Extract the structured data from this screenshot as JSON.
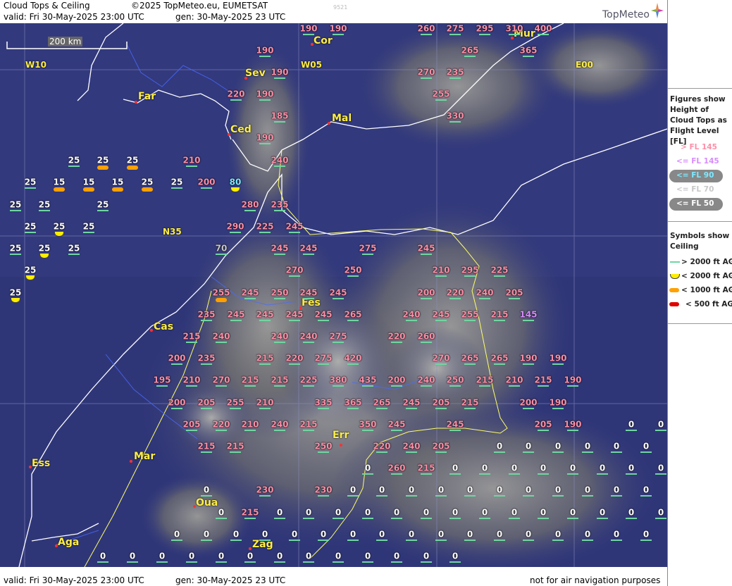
{
  "header": {
    "title": "Cloud Tops & Ceiling",
    "copyright": "©2025 TopMeteo.eu, EUMETSAT",
    "valid": "valid:  Fri  30-May-2025  23:00 UTC",
    "gen": "gen: 30-May-2025 23 UTC",
    "code": "9521",
    "brand": "TopMeteo"
  },
  "footer": {
    "valid": "valid:  Fri  30-May-2025  23:00 UTC",
    "gen": "gen: 30-May-2025 23 UTC",
    "disclaimer": "not for air navigation purposes"
  },
  "scale_label": "200 km",
  "grid_labels": [
    "W10",
    "W05",
    "E00",
    "N35"
  ],
  "cities": [
    "Cor",
    "Mur",
    "Sev",
    "Far",
    "Ced",
    "Mal",
    "Fes",
    "Cas",
    "Err",
    "Mar",
    "Ess",
    "Oua",
    "Aga",
    "Zag"
  ],
  "legend": {
    "figures_title": "Figures show Height of Cloud Tops as Flight Level  [FL]",
    "fl_items": [
      "> FL 145",
      "<= FL 145",
      "<= FL 90",
      "<= FL 70",
      "<= FL 50"
    ],
    "symbols_title": "Symbols show Ceiling",
    "ceiling_items": [
      "> 2000 ft AGL",
      "< 2000 ft AGL",
      "< 1000 ft AGL",
      "< 500 ft AGL"
    ],
    "colors": {
      "gt145": "#ff8fa8",
      "le145": "#d88cff",
      "le90": "#7fe8ff",
      "le70": "#c8c8c8",
      "le50": "#ffffff",
      "ceil_gt2000": "#6fd6a0",
      "ceil_lt2000": "#ffee00",
      "ceil_lt1000": "#ffa000",
      "ceil_lt500": "#e00000"
    }
  },
  "cloud_tops": [
    "190",
    "190",
    "260",
    "275",
    "295",
    "310",
    "400",
    "190",
    "265",
    "365",
    "190",
    "270",
    "235",
    "220",
    "190",
    "255",
    "185",
    "330",
    "190",
    "25",
    "25",
    "25",
    "210",
    "240",
    "25",
    "15",
    "15",
    "15",
    "25",
    "25",
    "200",
    "80",
    "25",
    "25",
    "25",
    "280",
    "235",
    "25",
    "25",
    "25",
    "290",
    "225",
    "245",
    "25",
    "25",
    "25",
    "70",
    "245",
    "245",
    "275",
    "245",
    "25",
    "270",
    "250",
    "210",
    "295",
    "225",
    "25",
    "255",
    "245",
    "250",
    "245",
    "245",
    "200",
    "220",
    "240",
    "205",
    "235",
    "245",
    "245",
    "245",
    "245",
    "265",
    "240",
    "245",
    "255",
    "215",
    "145",
    "215",
    "240",
    "240",
    "240",
    "275",
    "220",
    "260",
    "200",
    "235",
    "215",
    "220",
    "275",
    "420",
    "270",
    "265",
    "265",
    "190",
    "190",
    "195",
    "210",
    "270",
    "215",
    "215",
    "225",
    "380",
    "435",
    "200",
    "240",
    "250",
    "215",
    "210",
    "215",
    "190",
    "200",
    "205",
    "255",
    "210",
    "335",
    "365",
    "265",
    "245",
    "205",
    "215",
    "200",
    "190",
    "205",
    "220",
    "210",
    "240",
    "215",
    "350",
    "245",
    "245",
    "205",
    "190",
    "0",
    "0",
    "215",
    "215",
    "250",
    "220",
    "240",
    "205",
    "0",
    "0",
    "0",
    "0",
    "0",
    "0",
    "0",
    "260",
    "215",
    "0",
    "0",
    "0",
    "0",
    "0",
    "0",
    "0",
    "0",
    "0",
    "230",
    "230",
    "0",
    "0",
    "0",
    "0",
    "0",
    "0",
    "0",
    "0",
    "0",
    "0",
    "0",
    "0",
    "215",
    "0",
    "0",
    "0",
    "0",
    "0",
    "0",
    "0",
    "0",
    "0",
    "0",
    "0",
    "0",
    "0",
    "0",
    "0",
    "0",
    "0",
    "0",
    "0",
    "0",
    "0",
    "0",
    "0",
    "0",
    "0",
    "0",
    "0",
    "0",
    "0",
    "0",
    "0",
    "0",
    "0",
    "0",
    "0",
    "0",
    "0",
    "0",
    "0",
    "0",
    "0",
    "0",
    "0",
    "0"
  ]
}
